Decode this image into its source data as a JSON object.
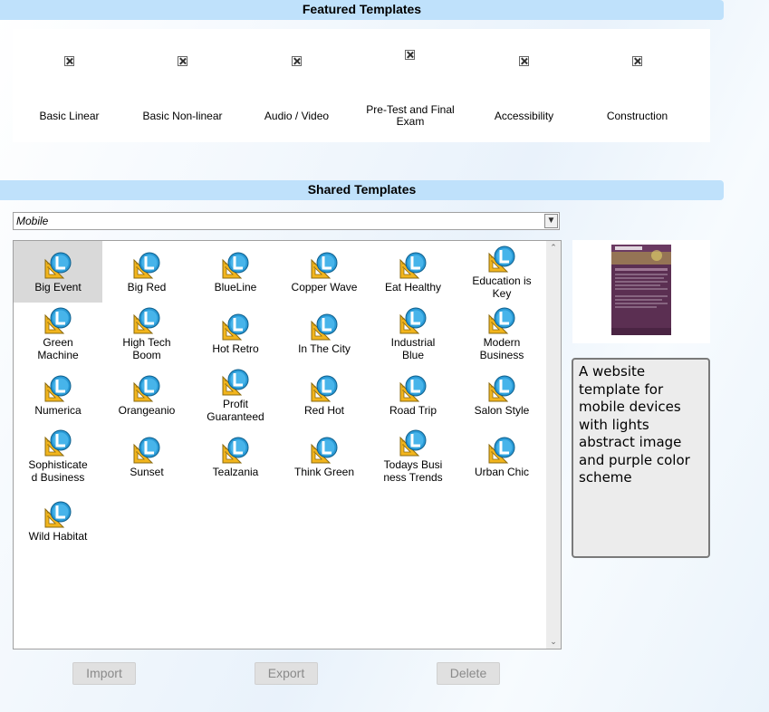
{
  "featured": {
    "title": "Featured Templates",
    "items": [
      {
        "label": "Basic Linear"
      },
      {
        "label": "Basic Non-linear"
      },
      {
        "label": "Audio / Video"
      },
      {
        "label": "Pre-Test and Final Exam"
      },
      {
        "label": "Accessibility"
      },
      {
        "label": "Construction"
      }
    ]
  },
  "shared": {
    "title": "Shared Templates",
    "filter": {
      "selected": "Mobile"
    },
    "templates": [
      {
        "label": "Big Event",
        "selected": true
      },
      {
        "label": "Big Red"
      },
      {
        "label": "BlueLine"
      },
      {
        "label": "Copper Wave"
      },
      {
        "label": "Eat Healthy"
      },
      {
        "label": "Education is Key"
      },
      {
        "label": "Green Machine"
      },
      {
        "label": "High Tech Boom"
      },
      {
        "label": "Hot Retro"
      },
      {
        "label": "In The City"
      },
      {
        "label": "Industrial Blue"
      },
      {
        "label": "Modern Business"
      },
      {
        "label": "Numerica"
      },
      {
        "label": "Orangeanio"
      },
      {
        "label": "Profit Guaranteed"
      },
      {
        "label": "Red Hot"
      },
      {
        "label": "Road Trip"
      },
      {
        "label": "Salon Style"
      },
      {
        "label": "Sophisticated Business"
      },
      {
        "label": "Sunset"
      },
      {
        "label": "Tealzania"
      },
      {
        "label": "Think Green"
      },
      {
        "label": "Todays Business Trends"
      },
      {
        "label": "Urban Chic"
      },
      {
        "label": "Wild Habitat"
      }
    ],
    "icon": "template-icon",
    "description": "A website template for mobile devices with lights abstract image and purple color scheme"
  },
  "buttons": {
    "import": "Import",
    "export": "Export",
    "delete": "Delete"
  },
  "colors": {
    "header_bg": "#bfe1fb",
    "selected_bg": "#d9d9d9",
    "preview_purple": "#5b2f52"
  }
}
